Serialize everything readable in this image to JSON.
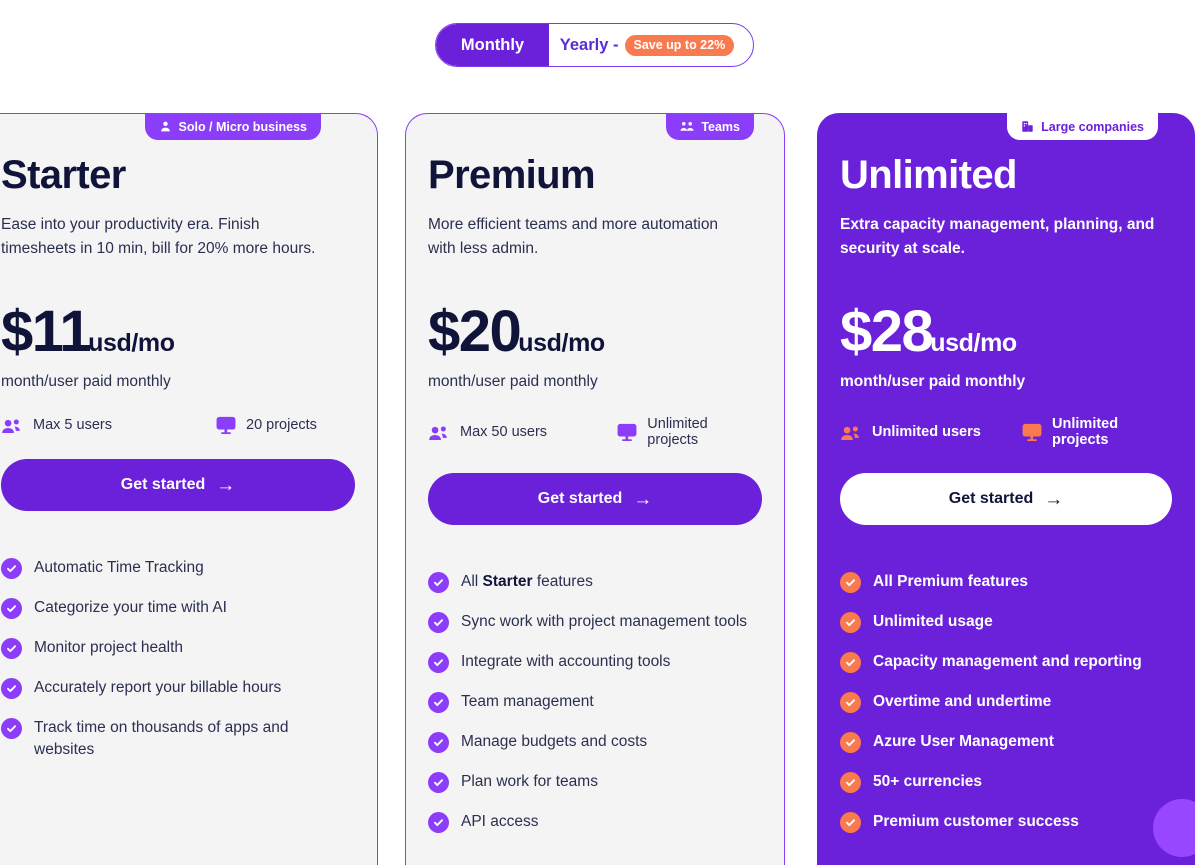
{
  "billing_toggle": {
    "monthly_label": "Monthly",
    "yearly_label": "Yearly -",
    "save_badge": "Save up to 22%",
    "selected": "Monthly"
  },
  "colors": {
    "primary_purple": "#6b21d9",
    "accent_purple": "#8b3dfa",
    "accent_orange": "#fa7a50",
    "dark_navy": "#111439",
    "card_light_bg": "#f4f4f5"
  },
  "plans": [
    {
      "id": "starter",
      "badge_label": "Solo / Micro business",
      "badge_icon": "single-person-icon",
      "name": "Starter",
      "description": "Ease into your productivity era. Finish timesheets in 10 min, bill for 20% more hours.",
      "price_amount": "$11",
      "price_unit": "usd/mo",
      "price_note": "month/user paid monthly",
      "meta": [
        {
          "icon": "people-icon",
          "label": "Max 5 users"
        },
        {
          "icon": "monitor-icon",
          "label": "20 projects"
        }
      ],
      "cta_label": "Get started",
      "cta_arrow": "→",
      "features": [
        "Automatic Time Tracking",
        "Categorize your time with AI",
        "Monitor project health",
        "Accurately report your billable hours",
        "Track time on thousands of apps and websites"
      ]
    },
    {
      "id": "premium",
      "badge_label": "Teams",
      "badge_icon": "people-group-icon",
      "name": "Premium",
      "description": "More efficient teams and more automation with less admin.",
      "price_amount": "$20",
      "price_unit": "usd/mo",
      "price_note": "month/user paid monthly",
      "meta": [
        {
          "icon": "people-icon",
          "label": "Max 50 users"
        },
        {
          "icon": "monitor-icon",
          "label": "Unlimited projects"
        }
      ],
      "cta_label": "Get started",
      "cta_arrow": "→",
      "features": [
        "All Starter features",
        "Sync work with project management tools",
        "Integrate with accounting tools",
        "Team management",
        "Manage budgets and costs",
        "Plan work for teams",
        "API access"
      ],
      "feature_bold_word": "Starter"
    },
    {
      "id": "unlimited",
      "badge_label": "Large companies",
      "badge_icon": "building-icon",
      "name": "Unlimited",
      "description": "Extra capacity management, planning, and security at scale.",
      "price_amount": "$28",
      "price_unit": "usd/mo",
      "price_note": "month/user paid monthly",
      "meta": [
        {
          "icon": "people-icon",
          "label": "Unlimited users"
        },
        {
          "icon": "monitor-icon",
          "label": "Unlimited projects"
        }
      ],
      "cta_label": "Get started",
      "cta_arrow": "→",
      "features": [
        "All Premium features",
        "Unlimited usage",
        "Capacity management and reporting",
        "Overtime and undertime",
        "Azure User Management",
        "50+ currencies",
        "Premium customer success"
      ]
    }
  ],
  "chat_widget": {
    "icon": "chat-bubble-icon"
  }
}
